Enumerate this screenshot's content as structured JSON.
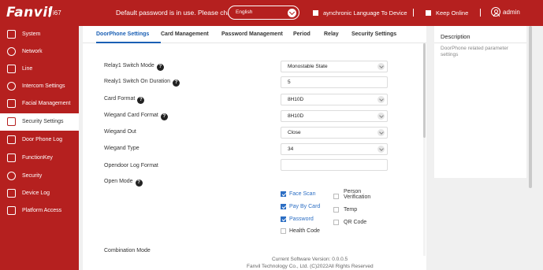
{
  "header": {
    "brand": "Fanvil",
    "model": "i67",
    "warning": "Default password is in use. Please change",
    "language": {
      "selected": "English"
    },
    "sync_label": "aynchronic Language To Device",
    "keep_online_label": "Keep Online",
    "user": "admin"
  },
  "sidebar": {
    "items": [
      {
        "label": "System",
        "icon": "home-icon"
      },
      {
        "label": "Network",
        "icon": "globe-icon"
      },
      {
        "label": "Line",
        "icon": "line-icon"
      },
      {
        "label": "Intercom Settings",
        "icon": "gear-icon"
      },
      {
        "label": "Facial Management",
        "icon": "face-icon"
      },
      {
        "label": "Security Settings",
        "icon": "security-settings-icon",
        "active": true
      },
      {
        "label": "Door Phone Log",
        "icon": "log-icon"
      },
      {
        "label": "FunctionKey",
        "icon": "keyboard-icon"
      },
      {
        "label": "Security",
        "icon": "shield-icon"
      },
      {
        "label": "Device Log",
        "icon": "device-log-icon"
      },
      {
        "label": "Platform Access",
        "icon": "platform-icon"
      }
    ]
  },
  "tabs": [
    {
      "label": "DoorPhone Settings",
      "active": true
    },
    {
      "label": "Card Management"
    },
    {
      "label": "Password Management"
    },
    {
      "label": "Period"
    },
    {
      "label": "Relay"
    },
    {
      "label": "Security Settings"
    }
  ],
  "form": {
    "relay1_mode": {
      "label": "Relay1 Switch Mode",
      "value": "Monostable State"
    },
    "relay1_duration": {
      "label": "Realy1 Switch On Duration",
      "value": "5"
    },
    "card_format": {
      "label": "Card Format",
      "value": "8H10D"
    },
    "wiegand_card_format": {
      "label": "Wiegand Card Format",
      "value": "8H10D"
    },
    "wiegand_out": {
      "label": "Wiegand Out",
      "value": "Close"
    },
    "wiegand_type": {
      "label": "Wiegand Type",
      "value": "34"
    },
    "opendoor_log_format": {
      "label": "Opendoor Log Format",
      "value": ""
    },
    "open_mode": {
      "label": "Open Mode",
      "options": [
        {
          "label": "Face Scan",
          "checked": true
        },
        {
          "label": "Pay By Card",
          "checked": true
        },
        {
          "label": "Password",
          "checked": true
        },
        {
          "label": "Health Code",
          "checked": false
        },
        {
          "label_line1": "Person",
          "label_line2": "Verification",
          "checked": false
        },
        {
          "label": "Temp",
          "checked": false
        },
        {
          "label": "QR Code",
          "checked": false
        }
      ]
    },
    "combination_mode": {
      "label": "Combination Mode"
    }
  },
  "description": {
    "title": "Description",
    "text": "DoorPhone related parameter settings"
  },
  "footer": {
    "version": "Current Software Version: 0.0.0.5",
    "copyright": "Fanvil Technology Co., Ltd. (C)2022All Rights Reserved"
  },
  "colors": {
    "brand_red": "#b5201f",
    "accent_blue": "#1a5fb4",
    "check_blue": "#2d6fc4"
  }
}
